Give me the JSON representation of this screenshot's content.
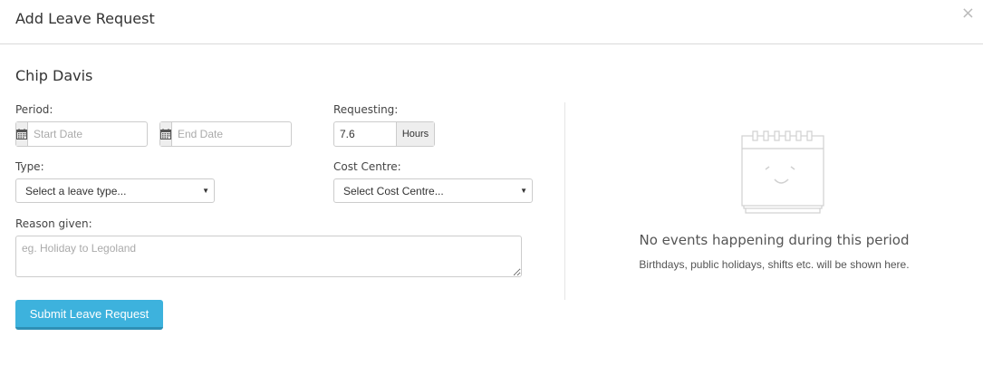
{
  "modal": {
    "title": "Add Leave Request",
    "close_symbol": "×"
  },
  "staff": {
    "name": "Chip Davis"
  },
  "form": {
    "period_label": "Period:",
    "start_date_placeholder": "Start Date",
    "end_date_placeholder": "End Date",
    "calendar_icon": "calendar-icon",
    "requesting_label": "Requesting:",
    "requesting_value": "7.6",
    "requesting_unit": "Hours",
    "type_label": "Type:",
    "type_selected": "Select a leave type...",
    "cost_centre_label": "Cost Centre:",
    "cost_centre_selected": "Select Cost Centre...",
    "reason_label": "Reason given:",
    "reason_placeholder": "eg. Holiday to Legoland",
    "submit_label": "Submit Leave Request"
  },
  "events_panel": {
    "illustration_icon": "empty-calendar-icon",
    "title": "No events happening during this period",
    "subtitle": "Birthdays, public holidays, shifts etc. will be shown here."
  },
  "colors": {
    "primary_button": "#3db2dd",
    "border": "#cccccc"
  }
}
